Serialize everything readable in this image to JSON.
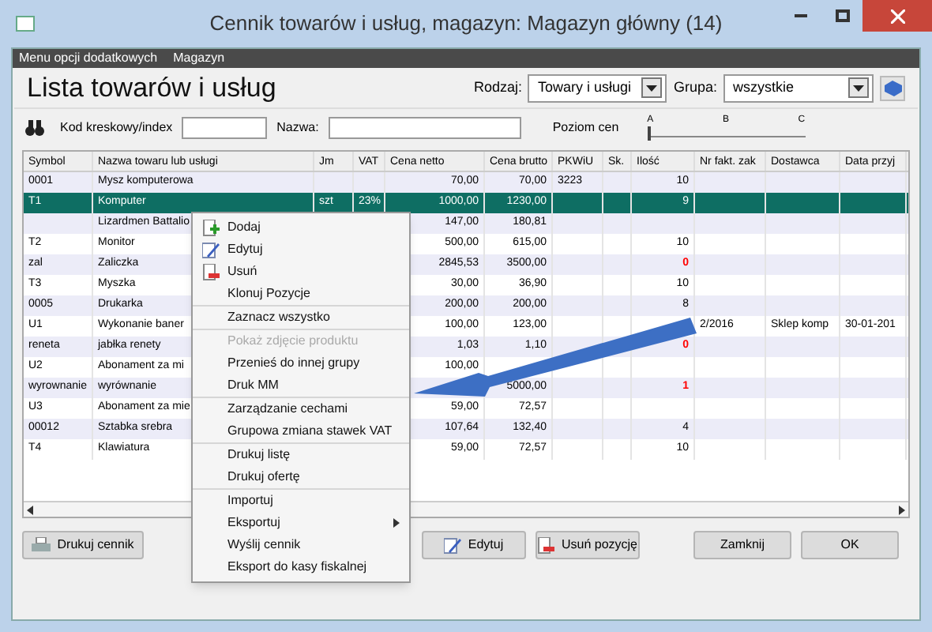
{
  "window": {
    "title": "Cennik towarów i usług, magazyn: Magazyn główny (14)"
  },
  "menu_bar": [
    "Menu opcji dodatkowych",
    "Magazyn"
  ],
  "heading": "Lista towarów i usług",
  "rodzaj": {
    "label": "Rodzaj:",
    "value": "Towary i usługi"
  },
  "grupa": {
    "label": "Grupa:",
    "value": "wszystkie"
  },
  "filters": {
    "barcode_label": "Kod kreskowy/index",
    "name_label": "Nazwa:"
  },
  "price_level": {
    "label": "Poziom cen",
    "ticks": [
      "A",
      "B",
      "C"
    ],
    "level": 0
  },
  "table": {
    "columns": [
      "Symbol",
      "Nazwa towaru lub usługi",
      "Jm",
      "VAT",
      "Cena netto",
      "Cena brutto",
      "PKWiU",
      "Sk.",
      "Ilość",
      "Nr fakt. zak",
      "Dostawca",
      "Data przyj"
    ],
    "rows": [
      {
        "selected": false,
        "alert": false,
        "symbol": "0001",
        "name": "Mysz komputerowa",
        "netto": "70,00",
        "brutto": "70,00",
        "pkwiu": "3223",
        "qty": "10"
      },
      {
        "selected": true,
        "alert": false,
        "symbol": "T1",
        "name": "Komputer",
        "jm": "szt",
        "vat": "23%",
        "netto": "1000,00",
        "brutto": "1230,00",
        "qty": "9"
      },
      {
        "selected": false,
        "name": "Lizardmen Battalio",
        "netto": "147,00",
        "brutto": "180,81"
      },
      {
        "selected": false,
        "alert": false,
        "symbol": "T2",
        "name": "Monitor",
        "netto": "500,00",
        "brutto": "615,00",
        "qty": "10"
      },
      {
        "selected": false,
        "alert": true,
        "symbol": "zal",
        "name": "Zaliczka",
        "netto": "2845,53",
        "brutto": "3500,00",
        "qty": "0"
      },
      {
        "selected": false,
        "alert": false,
        "symbol": "T3",
        "name": "Myszka",
        "netto": "30,00",
        "brutto": "36,90",
        "qty": "10"
      },
      {
        "selected": false,
        "alert": false,
        "symbol": "0005",
        "name": "Drukarka",
        "netto": "200,00",
        "brutto": "200,00",
        "qty": "8"
      },
      {
        "selected": false,
        "symbol": "U1",
        "name": "Wykonanie baner",
        "netto": "100,00",
        "brutto": "123,00",
        "invoice": "2/2016",
        "supplier": "Sklep komp",
        "date": "30-01-201"
      },
      {
        "selected": false,
        "alert": true,
        "symbol": "reneta",
        "name": "jabłka renety",
        "netto": "1,03",
        "brutto": "1,10",
        "qty": "0"
      },
      {
        "selected": false,
        "symbol": "U2",
        "name": "Abonament za mi",
        "netto": "100,00"
      },
      {
        "selected": false,
        "alert": true,
        "symbol": "wyrownanie",
        "name": "wyrównanie",
        "brutto": "5000,00",
        "qty": "1"
      },
      {
        "selected": false,
        "symbol": "U3",
        "name": "Abonament za mie",
        "netto": "59,00",
        "brutto": "72,57"
      },
      {
        "selected": false,
        "alert": false,
        "symbol": "00012",
        "name": "Sztabka srebra",
        "netto": "107,64",
        "brutto": "132,40",
        "qty": "4"
      },
      {
        "selected": false,
        "alert": false,
        "symbol": "T4",
        "name": "Klawiatura",
        "netto": "59,00",
        "brutto": "72,57",
        "qty": "10"
      }
    ]
  },
  "context_menu": {
    "groups": [
      [
        {
          "label": "Dodaj",
          "kind": "add",
          "disabled": false
        },
        {
          "label": "Edytuj",
          "kind": "edit",
          "disabled": false
        },
        {
          "label": "Usuń",
          "kind": "delete",
          "disabled": false
        },
        {
          "label": "Klonuj Pozycje",
          "kind": "text",
          "disabled": false
        }
      ],
      [
        {
          "label": "Zaznacz wszystko",
          "kind": "text",
          "disabled": false
        }
      ],
      [
        {
          "label": "Pokaż zdjęcie produktu",
          "kind": "text",
          "disabled": true
        },
        {
          "label": "Przenieś do innej grupy",
          "kind": "text",
          "disabled": false
        },
        {
          "label": "Druk MM",
          "kind": "text",
          "disabled": false
        }
      ],
      [
        {
          "label": "Zarządzanie cechami",
          "kind": "text",
          "disabled": false
        },
        {
          "label": "Grupowa zmiana stawek VAT",
          "kind": "text",
          "disabled": false
        }
      ],
      [
        {
          "label": "Drukuj listę",
          "kind": "text",
          "disabled": false
        },
        {
          "label": "Drukuj ofertę",
          "kind": "text",
          "disabled": false
        }
      ],
      [
        {
          "label": "Importuj",
          "kind": "text",
          "disabled": false
        },
        {
          "label": "Eksportuj",
          "kind": "submenu",
          "disabled": false
        },
        {
          "label": "Wyślij cennik",
          "kind": "text",
          "disabled": false
        },
        {
          "label": "Eksport do kasy fiskalnej",
          "kind": "text",
          "disabled": false
        }
      ]
    ]
  },
  "buttons": [
    {
      "label": "Drukuj cennik",
      "kind": "print"
    },
    {
      "label": "Edytuj",
      "kind": "edit"
    },
    {
      "label": "Usuń pozycję",
      "kind": "delete"
    },
    {
      "label": "Zamknij",
      "kind": "text"
    },
    {
      "label": "OK",
      "kind": "text"
    }
  ]
}
